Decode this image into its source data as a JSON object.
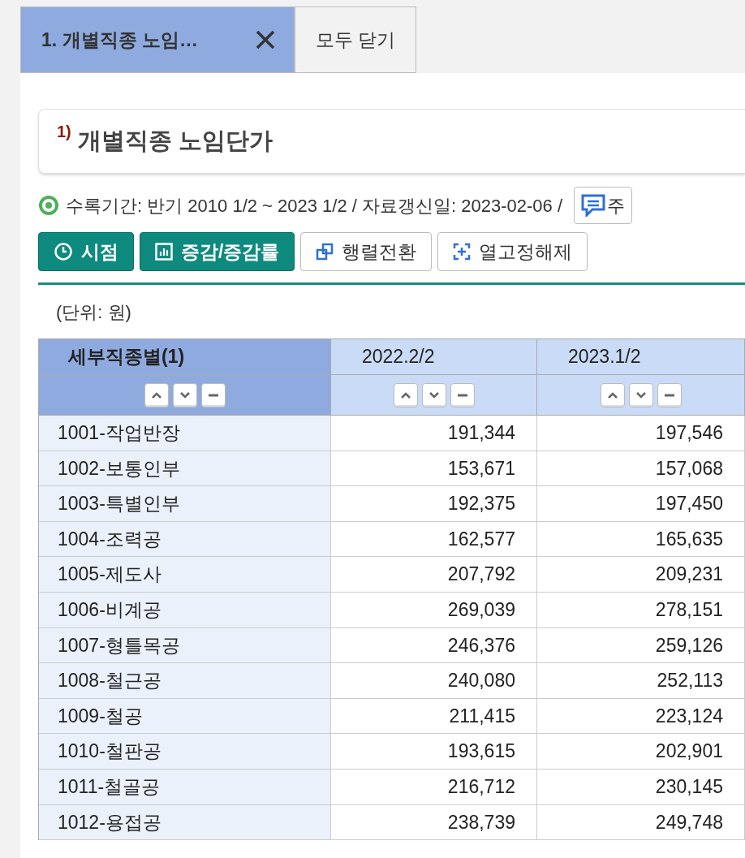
{
  "tabs": [
    {
      "label": "1. 개별직종 노임…",
      "selected": true,
      "closable": true
    },
    {
      "label": "모두 닫기",
      "selected": false,
      "closable": false
    }
  ],
  "title": {
    "note": "1)",
    "text": "개별직종 노임단가"
  },
  "info": {
    "text": "수록기간: 반기 2010 1/2 ~ 2023 1/2 / 자료갱신일: 2023-02-06 /",
    "button": "주"
  },
  "toolbar": [
    {
      "label": "시점",
      "kind": "primary"
    },
    {
      "label": "증감/증감률",
      "kind": "primary"
    },
    {
      "label": "행렬전환",
      "kind": "secondary"
    },
    {
      "label": "열고정해제",
      "kind": "secondary"
    }
  ],
  "unit": "(단위: 원)",
  "table": {
    "columns": [
      "세부직종별(1)",
      "2022.2/2",
      "2023.1/2"
    ],
    "rows": [
      [
        "1001-작업반장",
        "191,344",
        "197,546"
      ],
      [
        "1002-보통인부",
        "153,671",
        "157,068"
      ],
      [
        "1003-특별인부",
        "192,375",
        "197,450"
      ],
      [
        "1004-조력공",
        "162,577",
        "165,635"
      ],
      [
        "1005-제도사",
        "207,792",
        "209,231"
      ],
      [
        "1006-비계공",
        "269,039",
        "278,151"
      ],
      [
        "1007-형틀목공",
        "246,376",
        "259,126"
      ],
      [
        "1008-철근공",
        "240,080",
        "252,113"
      ],
      [
        "1009-철공",
        "211,415",
        "223,124"
      ],
      [
        "1010-철판공",
        "193,615",
        "202,901"
      ],
      [
        "1011-철골공",
        "216,712",
        "230,145"
      ],
      [
        "1012-용접공",
        "238,739",
        "249,748"
      ]
    ]
  }
}
